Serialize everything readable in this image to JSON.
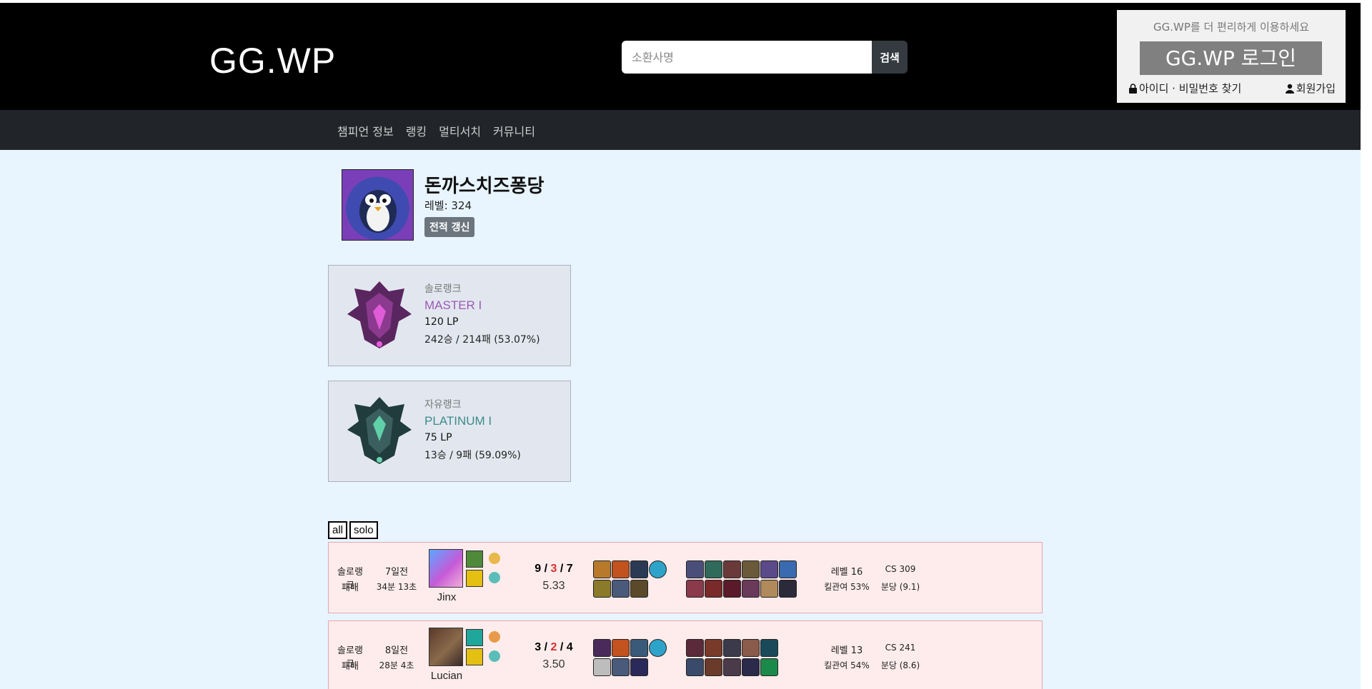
{
  "header": {
    "logo": "GG.WP",
    "search_placeholder": "소환사명",
    "search_button": "검색"
  },
  "login": {
    "hint": "GG.WP를 더 편리하게 이용하세요",
    "button": "GG.WP 로그인",
    "find_account": "아이디 · 비밀번호 찾기",
    "signup": "회원가입"
  },
  "nav": [
    "챔피언 정보",
    "랭킹",
    "멀티서치",
    "커뮤니티"
  ],
  "profile": {
    "name": "돈까스치즈퐁당",
    "level": "레벨: 324",
    "refresh": "전적 갱신"
  },
  "ranks": [
    {
      "type": "솔로랭크",
      "tier": "MASTER I",
      "lp": "120 LP",
      "record": "242승 / 214패 (53.07%)",
      "tier_color": "#9b59b6"
    },
    {
      "type": "자유랭크",
      "tier": "PLATINUM I",
      "lp": "75 LP",
      "record": "13승 / 9패 (59.09%)",
      "tier_color": "#3d8b8b"
    }
  ],
  "filters": [
    "all",
    "solo"
  ],
  "matches": [
    {
      "queue": "솔로랭크",
      "result": "패배",
      "ago": "7일전",
      "duration": "34분 13초",
      "champion": "Jinx",
      "kills": "9",
      "deaths": "3",
      "assists": "7",
      "ratio": "5.33",
      "level": "레벨 16",
      "kp": "킬관여 53%",
      "cs": "CS 309",
      "cs_per_min": "분당 (9.1)"
    },
    {
      "queue": "솔로랭크",
      "result": "패배",
      "ago": "8일전",
      "duration": "28분 4초",
      "champion": "Lucian",
      "kills": "3",
      "deaths": "2",
      "assists": "4",
      "ratio": "3.50",
      "level": "레벨 13",
      "kp": "킬관여 54%",
      "cs": "CS 241",
      "cs_per_min": "분당 (8.6)"
    }
  ]
}
